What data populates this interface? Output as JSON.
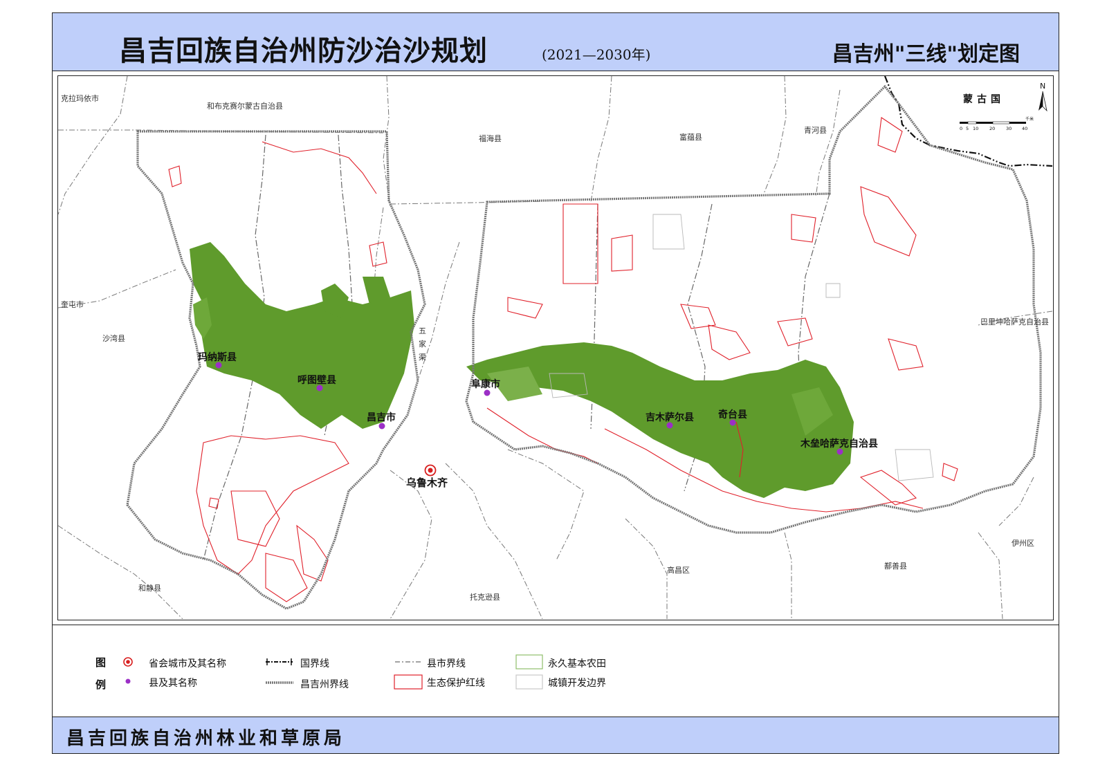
{
  "header": {
    "title": "昌吉回族自治州防沙治沙规划",
    "years": "(2021—2030年)",
    "subtitle": "昌吉州\"三线\"划定图"
  },
  "map": {
    "neighbor_labels": {
      "karamay": "克拉玛依市",
      "hoboksar": "和布克赛尔蒙古自治县",
      "fuhai": "福海县",
      "fuyun": "富蕴县",
      "qinghe": "青河县",
      "mongolia": "蒙古国",
      "kuitun": "奎屯市",
      "shawan": "沙湾县",
      "wujiaqu": "五家渠",
      "barkol": "巴里坤哈萨克自治县",
      "yizhou": "伊州区",
      "shanshan": "鄯善县",
      "gaochang": "高昌区",
      "toksun": "托克逊县",
      "hejing": "和静县"
    },
    "capital_label": "乌鲁木齐",
    "counties": {
      "manas": "玛纳斯县",
      "hutubi": "呼图壁县",
      "changji": "昌吉市",
      "fukang": "阜康市",
      "jimsar": "吉木萨尔县",
      "qitai": "奇台县",
      "mori": "木垒哈萨克自治县"
    },
    "north_arrow": "N",
    "scale": {
      "ticks": [
        "0",
        "5",
        "10",
        "20",
        "30",
        "40"
      ],
      "unit": "千米"
    }
  },
  "legend": {
    "tag_top": "图",
    "tag_bottom": "例",
    "items": {
      "capital": "省会城市及其名称",
      "county": "县及其名称",
      "national_border": "国界线",
      "prefecture_border": "昌吉州界线",
      "county_border": "县市界线",
      "eco_redline": "生态保护红线",
      "farmland": "永久基本农田",
      "urban_boundary": "城镇开发边界"
    }
  },
  "footer": {
    "agency": "昌吉回族自治州林业和草原局"
  },
  "colors": {
    "header_bg": "#bfcffa",
    "farmland": "#5f9b2c",
    "eco_redline": "#e0202a",
    "county_dot": "#9b2fc6",
    "prefecture_border": "#777777",
    "capital_symbol": "#d81e1e"
  }
}
